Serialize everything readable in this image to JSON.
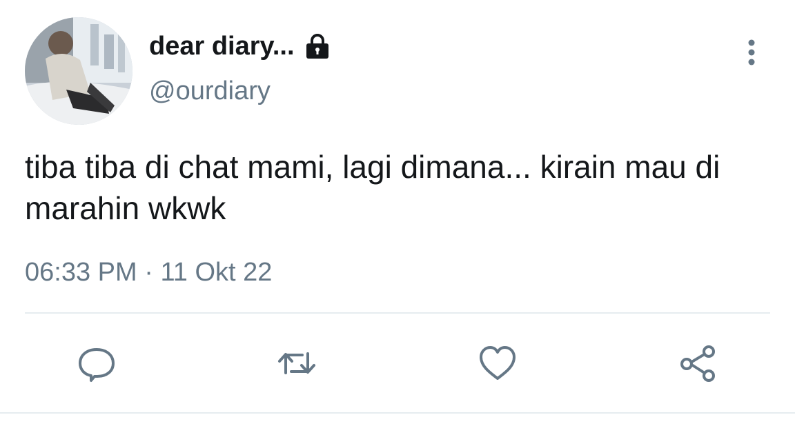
{
  "tweet": {
    "display_name": "dear diary...",
    "handle": "@ourdiary",
    "text": "tiba tiba di chat mami, lagi dimana... kirain mau di marahin wkwk",
    "time": "06:33 PM",
    "separator": "·",
    "date": "11 Okt 22"
  },
  "icons": {
    "protected": "lock-icon",
    "more": "more-vertical-icon",
    "reply": "reply-icon",
    "retweet": "retweet-icon",
    "like": "heart-icon",
    "share": "share-icon"
  },
  "colors": {
    "primary_text": "#14171a",
    "secondary_text": "#657786",
    "divider": "#e6ecf0"
  }
}
